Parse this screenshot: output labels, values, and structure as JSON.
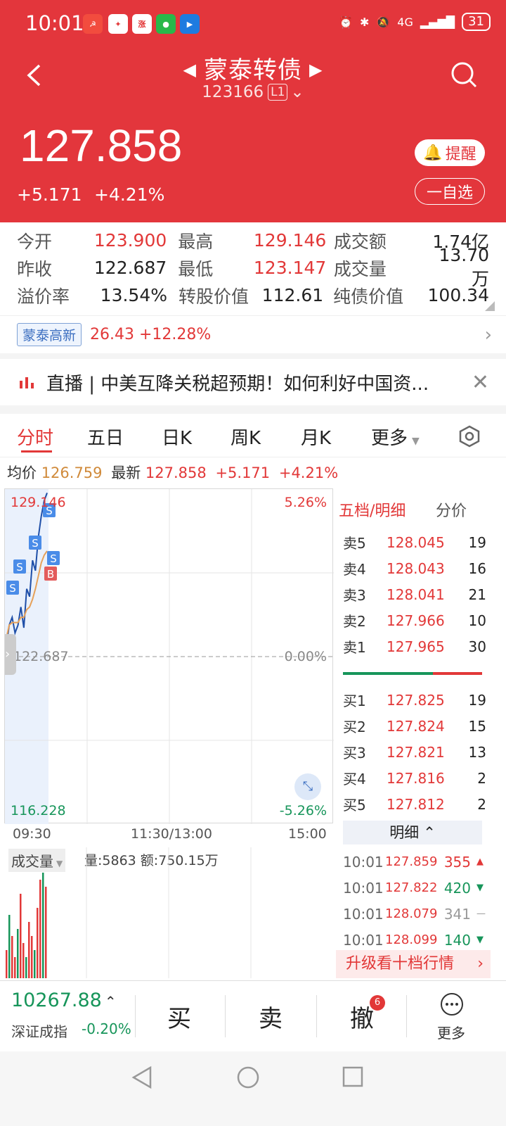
{
  "status": {
    "time": "10:01",
    "network": "4G",
    "battery": "31"
  },
  "header": {
    "name": "蒙泰转债",
    "code": "123166",
    "level": "L1",
    "price": "127.858",
    "change": "+5.171",
    "change_pct": "+4.21%",
    "alarm_btn": "提醒",
    "watch_btn": "一自选"
  },
  "quote": {
    "r1": {
      "l1": "今开",
      "v1": "123.900",
      "l2": "最高",
      "v2": "129.146",
      "l3": "成交额",
      "v3": "1.74亿"
    },
    "r2": {
      "l1": "昨收",
      "v1": "122.687",
      "l2": "最低",
      "v2": "123.147",
      "l3": "成交量",
      "v3": "13.70万"
    },
    "r3": {
      "l1": "溢价率",
      "v1": "13.54%",
      "l2": "转股价值",
      "v2": "112.61",
      "l3": "纯债价值",
      "v3": "100.34"
    }
  },
  "stock": {
    "tag": "蒙泰高新",
    "value": "26.43 +12.28%"
  },
  "live": {
    "text": "直播 | 中美互降关税超预期！如何利好中国资..."
  },
  "tabs": [
    "分时",
    "五日",
    "日K",
    "周K",
    "月K",
    "更多"
  ],
  "avg": {
    "label1": "均价",
    "avg": "126.759",
    "label2": "最新",
    "last": "127.858",
    "chg": "+5.171",
    "pct": "+4.21%"
  },
  "chart": {
    "ymax": "129.146",
    "ymin": "116.228",
    "mid": "122.687",
    "pmax": "5.26%",
    "pmin": "-5.26%",
    "pmid": "0.00%",
    "t1": "09:30",
    "t2": "11:30/13:00",
    "t3": "15:00",
    "S": "S",
    "B": "B"
  },
  "chart_data": {
    "type": "line",
    "x_start": "09:30",
    "x_end": "15:00",
    "series": [
      {
        "values": [
          123.1,
          123.9,
          124.2,
          123.6,
          123.9,
          124.6,
          123.8,
          125.3,
          125.0,
          126.4,
          126.0,
          127.3,
          128.1,
          128.7,
          129.0
        ]
      },
      {
        "values": [
          123.4,
          123.9,
          124.0,
          124.0,
          124.0,
          124.2,
          124.2,
          124.5,
          124.6,
          124.9,
          125.3,
          125.8,
          126.3,
          126.6,
          126.76
        ]
      }
    ],
    "volume": [
      40,
      90,
      60,
      30,
      70,
      120,
      50,
      30,
      80,
      60,
      40,
      100,
      140,
      150,
      130
    ],
    "ylim": [
      116.228,
      129.146
    ]
  },
  "volume": {
    "label": "成交量",
    "stats": "量:5863 额:750.15万"
  },
  "orderbook": {
    "title": "五档/明细",
    "title2": "分价",
    "asks": [
      {
        "l": "卖5",
        "p": "128.045",
        "q": "19"
      },
      {
        "l": "卖4",
        "p": "128.043",
        "q": "16"
      },
      {
        "l": "卖3",
        "p": "128.041",
        "q": "21"
      },
      {
        "l": "卖2",
        "p": "127.966",
        "q": "10"
      },
      {
        "l": "卖1",
        "p": "127.965",
        "q": "30"
      }
    ],
    "bids": [
      {
        "l": "买1",
        "p": "127.825",
        "q": "19"
      },
      {
        "l": "买2",
        "p": "127.824",
        "q": "15"
      },
      {
        "l": "买3",
        "p": "127.821",
        "q": "13"
      },
      {
        "l": "买4",
        "p": "127.816",
        "q": "2"
      },
      {
        "l": "买5",
        "p": "127.812",
        "q": "2"
      }
    ],
    "detail_title": "明细",
    "ticks": [
      {
        "t": "10:01",
        "p": "127.859",
        "q": "355"
      },
      {
        "t": "10:01",
        "p": "127.822",
        "q": "420"
      },
      {
        "t": "10:01",
        "p": "128.079",
        "q": "341"
      },
      {
        "t": "10:01",
        "p": "128.099",
        "q": "140"
      }
    ],
    "upgrade": "升级看十档行情"
  },
  "index": {
    "value": "10267.88",
    "name": "深证成指",
    "pct": "-0.20%"
  },
  "actions": {
    "buy": "买",
    "sell": "卖",
    "cancel": "撤",
    "badge": "6",
    "more": "更多"
  },
  "colors": {
    "brand": "#e3363c",
    "up": "#e23838",
    "down": "#17955a"
  }
}
